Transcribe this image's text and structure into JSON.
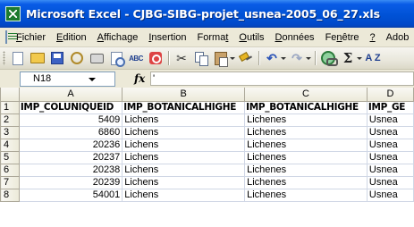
{
  "window": {
    "title": "Microsoft Excel - CJBG-SIBG-projet_usnea-2005_06_27.xls"
  },
  "menu": [
    {
      "label": "Fichier",
      "u": "F",
      "rest": "ichier"
    },
    {
      "label": "Edition",
      "u": "E",
      "rest": "dition"
    },
    {
      "label": "Affichage",
      "u": "A",
      "rest": "ffichage"
    },
    {
      "label": "Insertion",
      "u": "I",
      "rest": "nsertion"
    },
    {
      "label": "Format",
      "pre": "Forma",
      "u": "t",
      "rest": ""
    },
    {
      "label": "Outils",
      "u": "O",
      "rest": "utils"
    },
    {
      "label": "Données",
      "u": "D",
      "rest": "onnées"
    },
    {
      "label": "Fenêtre",
      "pre": "Fe",
      "u": "n",
      "rest": "être"
    },
    {
      "label": "?",
      "u": "?",
      "rest": ""
    },
    {
      "label": "Adob",
      "u": "",
      "rest": "Adob"
    }
  ],
  "toolbar": {
    "icons": [
      "new-icon",
      "open-icon",
      "save-icon",
      "permission-icon",
      "print-icon",
      "print-preview-icon",
      "spelling-icon",
      "research-icon",
      "cut-icon",
      "copy-icon",
      "paste-icon",
      "format-painter-icon",
      "undo-icon",
      "redo-icon",
      "hyperlink-icon",
      "autosum-icon",
      "sort-ascending-icon"
    ],
    "spelling_glyph": "ABC",
    "cut_glyph": "✂",
    "undo_glyph": "↶",
    "redo_glyph": "↷",
    "sigma_glyph": "Σ",
    "sort_glyph": "A Z"
  },
  "formula_bar": {
    "name_box": "N18",
    "fx_label": "fx",
    "content": "'"
  },
  "grid": {
    "columns": [
      "A",
      "B",
      "C",
      "D"
    ],
    "rows": [
      {
        "num": "1",
        "cells": [
          "IMP_COLUNIQUEID",
          "IMP_BOTANICALHIGHE",
          "IMP_BOTANICALHIGHE",
          "IMP_GE"
        ]
      },
      {
        "num": "2",
        "cells": [
          "5409",
          "Lichens",
          "Lichenes",
          "Usnea"
        ]
      },
      {
        "num": "3",
        "cells": [
          "6860",
          "Lichens",
          "Lichenes",
          "Usnea"
        ]
      },
      {
        "num": "4",
        "cells": [
          "20236",
          "Lichens",
          "Lichenes",
          "Usnea"
        ]
      },
      {
        "num": "5",
        "cells": [
          "20237",
          "Lichens",
          "Lichenes",
          "Usnea"
        ]
      },
      {
        "num": "6",
        "cells": [
          "20238",
          "Lichens",
          "Lichenes",
          "Usnea"
        ]
      },
      {
        "num": "7",
        "cells": [
          "20239",
          "Lichens",
          "Lichenes",
          "Usnea"
        ]
      },
      {
        "num": "8",
        "cells": [
          "54001",
          "Lichens",
          "Lichenes",
          "Usnea"
        ]
      }
    ]
  }
}
